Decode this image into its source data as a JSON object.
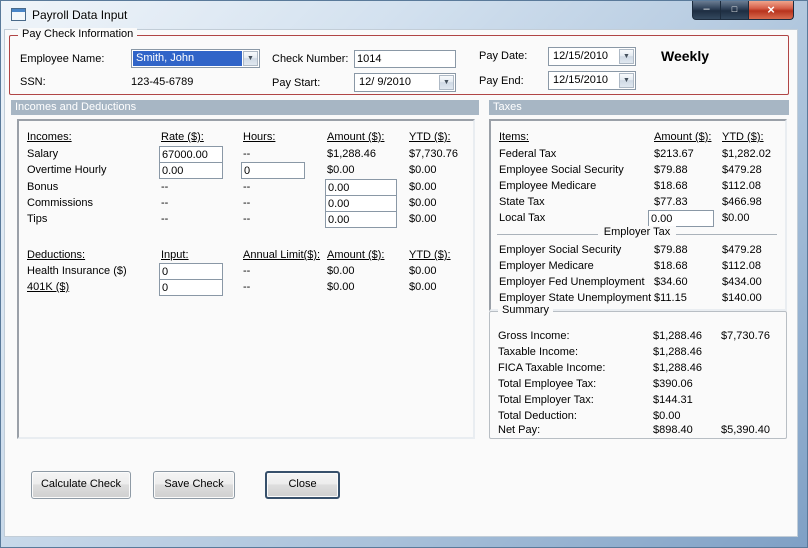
{
  "titlebar": {
    "title": "Payroll Data Input",
    "minimize_glyph": "–",
    "maximize_glyph": "□",
    "close_glyph": "×"
  },
  "icons": {
    "dropdown": "▼"
  },
  "colors": {
    "paycheck_border": "#b04545",
    "section_header_bg": "#a7b6c4",
    "selection_blue": "#3064c8",
    "close_button_red": "#b8331d"
  },
  "paycheck": {
    "legend": "Pay Check Information",
    "employee_name_label": "Employee Name:",
    "employee_name_value": "Smith, John",
    "ssn_label": "SSN:",
    "ssn_value": "123-45-6789",
    "check_number_label": "Check Number:",
    "check_number_value": "1014",
    "pay_start_label": "Pay Start:",
    "pay_start_value": "12/ 9/2010",
    "pay_date_label": "Pay Date:",
    "pay_date_value": "12/15/2010",
    "pay_end_label": "Pay End:",
    "pay_end_value": "12/15/2010",
    "frequency": "Weekly"
  },
  "sections": {
    "incomes_header": "Incomes and Deductions",
    "taxes_header": "Taxes"
  },
  "incomes": {
    "col_label": "Incomes:",
    "col_rate": "Rate ($):",
    "col_hours": "Hours:",
    "col_amount": "Amount ($):",
    "col_ytd": "YTD ($):",
    "salary": {
      "label": "Salary",
      "rate": "67000.00",
      "hours": "--",
      "amount": "$1,288.46",
      "ytd": "$7,730.76"
    },
    "overtime": {
      "label": "Overtime Hourly",
      "rate": "0.00",
      "hours": "0",
      "amount": "$0.00",
      "ytd": "$0.00"
    },
    "bonus": {
      "label": "Bonus",
      "rate": "--",
      "hours": "--",
      "amount": "0.00",
      "ytd": "$0.00"
    },
    "commissions": {
      "label": "Commissions",
      "rate": "--",
      "hours": "--",
      "amount": "0.00",
      "ytd": "$0.00"
    },
    "tips": {
      "label": "Tips",
      "rate": "--",
      "hours": "--",
      "amount": "0.00",
      "ytd": "$0.00"
    }
  },
  "deductions": {
    "col_label": "Deductions:",
    "col_input": "Input:",
    "col_limit": "Annual Limit($):",
    "col_amount": "Amount ($):",
    "col_ytd": "YTD ($):",
    "health": {
      "label": "Health Insurance  ($)",
      "input": "0",
      "limit": "--",
      "amount": "$0.00",
      "ytd": "$0.00"
    },
    "k401": {
      "label": "401K  ($)",
      "input": "0",
      "limit": "--",
      "amount": "$0.00",
      "ytd": "$0.00"
    }
  },
  "taxes": {
    "col_items": "Items:",
    "col_amount": "Amount ($):",
    "col_ytd": "YTD ($):",
    "rows": [
      {
        "label": "Federal Tax",
        "amount": "$213.67",
        "ytd": "$1,282.02"
      },
      {
        "label": "Employee Social Security",
        "amount": "$79.88",
        "ytd": "$479.28"
      },
      {
        "label": "Employee Medicare",
        "amount": "$18.68",
        "ytd": "$112.08"
      },
      {
        "label": "State Tax",
        "amount": "$77.83",
        "ytd": "$466.98"
      }
    ],
    "local_tax": {
      "label": "Local Tax",
      "amount": "0.00",
      "ytd": "$0.00"
    },
    "employer_header": "Employer Tax",
    "employer_rows": [
      {
        "label": "Employer Social Security",
        "amount": "$79.88",
        "ytd": "$479.28"
      },
      {
        "label": "Employer Medicare",
        "amount": "$18.68",
        "ytd": "$112.08"
      },
      {
        "label": "Employer Fed Unemployment",
        "amount": "$34.60",
        "ytd": "$434.00"
      },
      {
        "label": "Employer State Unemployment",
        "amount": "$11.15",
        "ytd": "$140.00"
      }
    ]
  },
  "summary": {
    "legend": "Summary",
    "rows": [
      {
        "label": "Gross Income:",
        "amount": "$1,288.46",
        "ytd": "$7,730.76"
      },
      {
        "label": "Taxable Income:",
        "amount": "$1,288.46",
        "ytd": ""
      },
      {
        "label": "FICA Taxable Income:",
        "amount": "$1,288.46",
        "ytd": ""
      },
      {
        "label": "Total Employee Tax:",
        "amount": "$390.06",
        "ytd": ""
      },
      {
        "label": "Total Employer Tax:",
        "amount": "$144.31",
        "ytd": ""
      },
      {
        "label": "Total Deduction:",
        "amount": "$0.00",
        "ytd": ""
      },
      {
        "label": "Net Pay:",
        "amount": "$898.40",
        "ytd": "$5,390.40"
      }
    ]
  },
  "actions": {
    "calculate": "Calculate Check",
    "save": "Save Check",
    "close": "Close"
  }
}
